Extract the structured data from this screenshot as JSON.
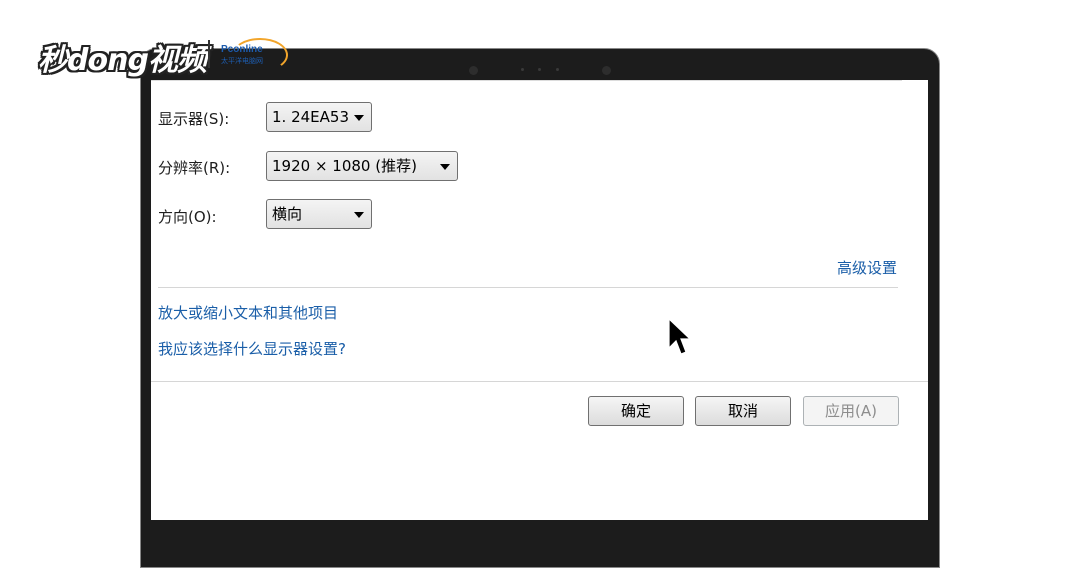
{
  "watermark": {
    "brand": "秒dong视频",
    "partner": "Pconline",
    "partner_sub": "太平洋电脑网"
  },
  "settings": {
    "display_label": "显示器(S):",
    "display_value": "1. 24EA53",
    "resolution_label": "分辨率(R):",
    "resolution_value": "1920 × 1080 (推荐)",
    "orientation_label": "方向(O):",
    "orientation_value": "横向",
    "advanced_link": "高级设置",
    "link_text_size": "放大或缩小文本和其他项目",
    "link_which_settings": "我应该选择什么显示器设置?"
  },
  "buttons": {
    "ok": "确定",
    "cancel": "取消",
    "apply": "应用(A)"
  },
  "colors": {
    "link": "#1a5ea8",
    "bezel": "#1c1c1c"
  }
}
